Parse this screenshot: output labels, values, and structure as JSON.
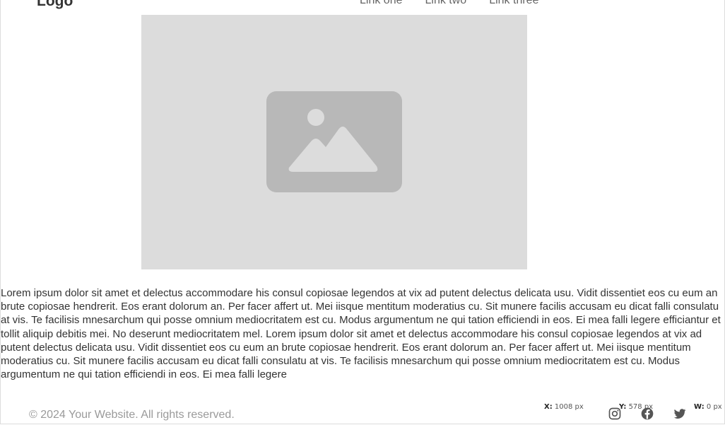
{
  "header": {
    "logo": "Logo",
    "nav": [
      "Link one",
      "Link two",
      "Link three"
    ]
  },
  "hero": {
    "icon": "image-placeholder-icon"
  },
  "content": {
    "paragraph": "Lorem ipsum dolor sit amet et delectus accommodare his consul copiosae legendos at vix ad putent delectus delicata usu. Vidit dissentiet eos cu eum an brute copiosae hendrerit. Eos erant dolorum an. Per facer affert ut. Mei iisque mentitum moderatius cu. Sit munere facilis accusam eu dicat falli consulatu at vis. Te facilisis mnesarchum qui posse omnium mediocritatem est cu. Modus argumentum ne qui tation efficiendi in eos. Ei mea falli legere efficiantur et tollit aliquip debitis mei. No deserunt mediocritatem mel. Lorem ipsum dolor sit amet et delectus accommodare his consul copiosae legendos at vix ad putent delectus delicata usu. Vidit dissentiet eos cu eum an brute copiosae hendrerit. Eos erant dolorum an. Per facer affert ut. Mei iisque mentitum moderatius cu. Sit munere facilis accusam eu dicat falli consulatu at vis. Te facilisis mnesarchum qui posse omnium mediocritatem est cu. Modus argumentum ne qui tation efficiendi in eos. Ei mea falli legere"
  },
  "footer": {
    "copyright": "© 2024 Your Website. All rights reserved.",
    "social": [
      "instagram-icon",
      "facebook-icon",
      "twitter-icon"
    ]
  },
  "inspector": {
    "x_label": "X:",
    "x_value": "1008 px",
    "y_label": "Y:",
    "y_value": "578 px",
    "w_label": "W:",
    "w_value": "0 px"
  },
  "colors": {
    "placeholder_bg": "#dcdcdc",
    "placeholder_icon": "#b8b8b8",
    "muted_text": "#9a9a9a"
  }
}
